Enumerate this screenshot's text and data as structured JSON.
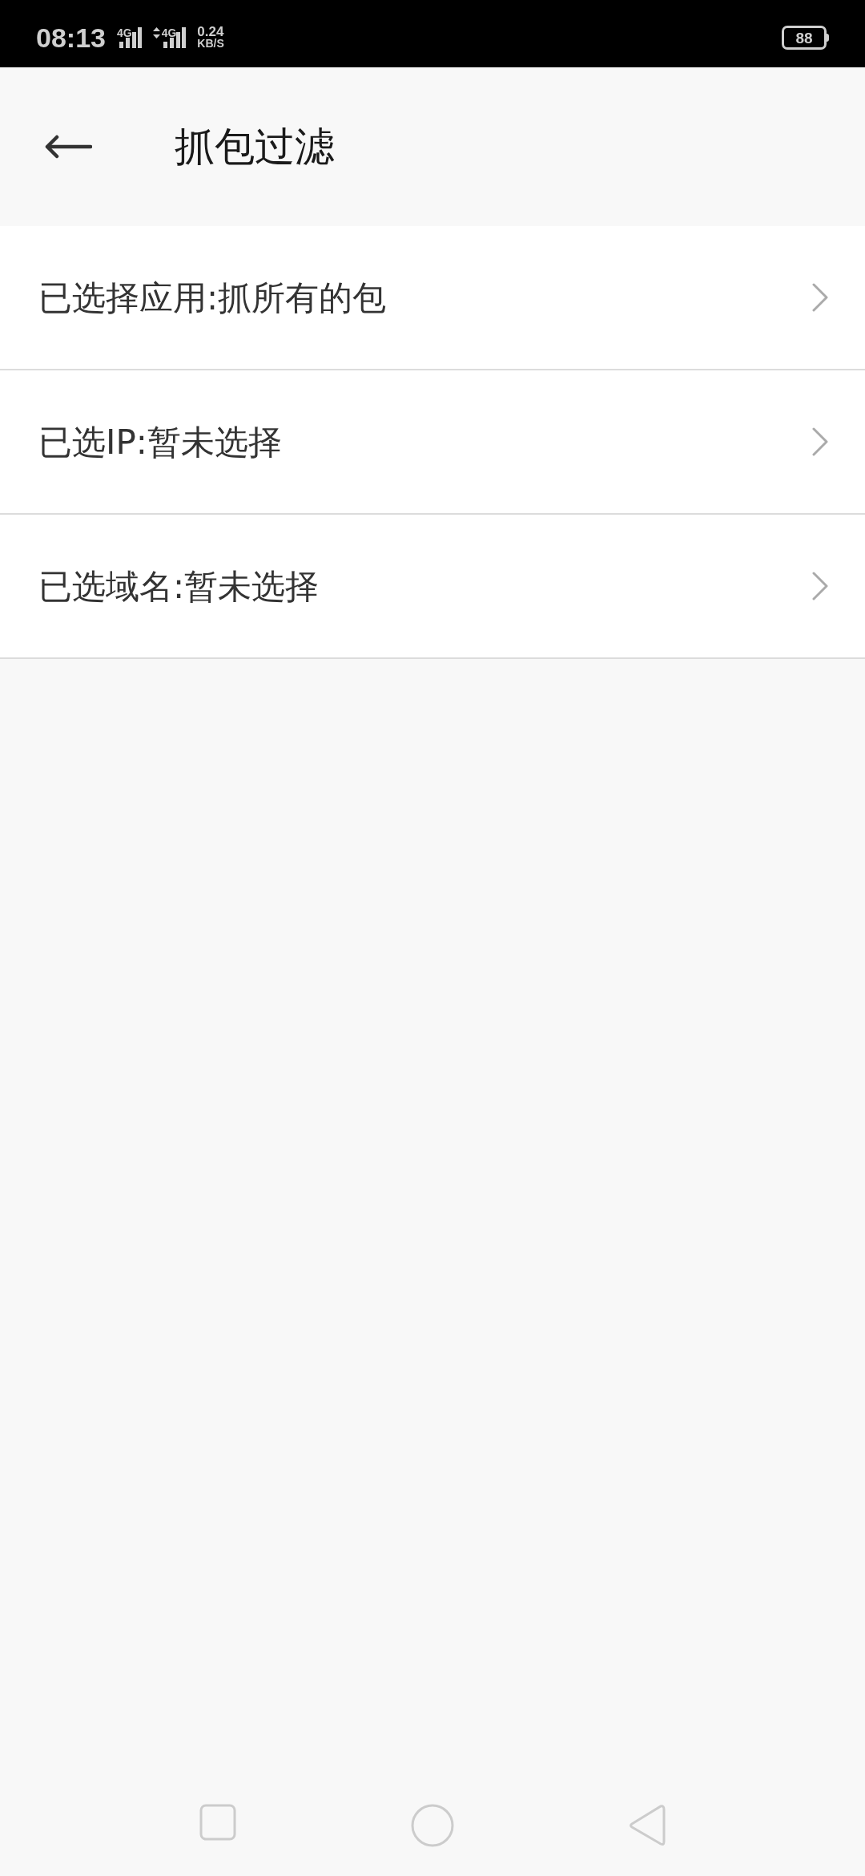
{
  "status_bar": {
    "time": "08:13",
    "sim1_network": "4G",
    "sim2_network": "4G",
    "speed_value": "0.24",
    "speed_unit": "KB/S",
    "battery": "88"
  },
  "header": {
    "title": "抓包过滤"
  },
  "filters": [
    {
      "label": "已选择应用:抓所有的包"
    },
    {
      "label": "已选IP:暂未选择"
    },
    {
      "label": "已选域名:暂未选择"
    }
  ]
}
